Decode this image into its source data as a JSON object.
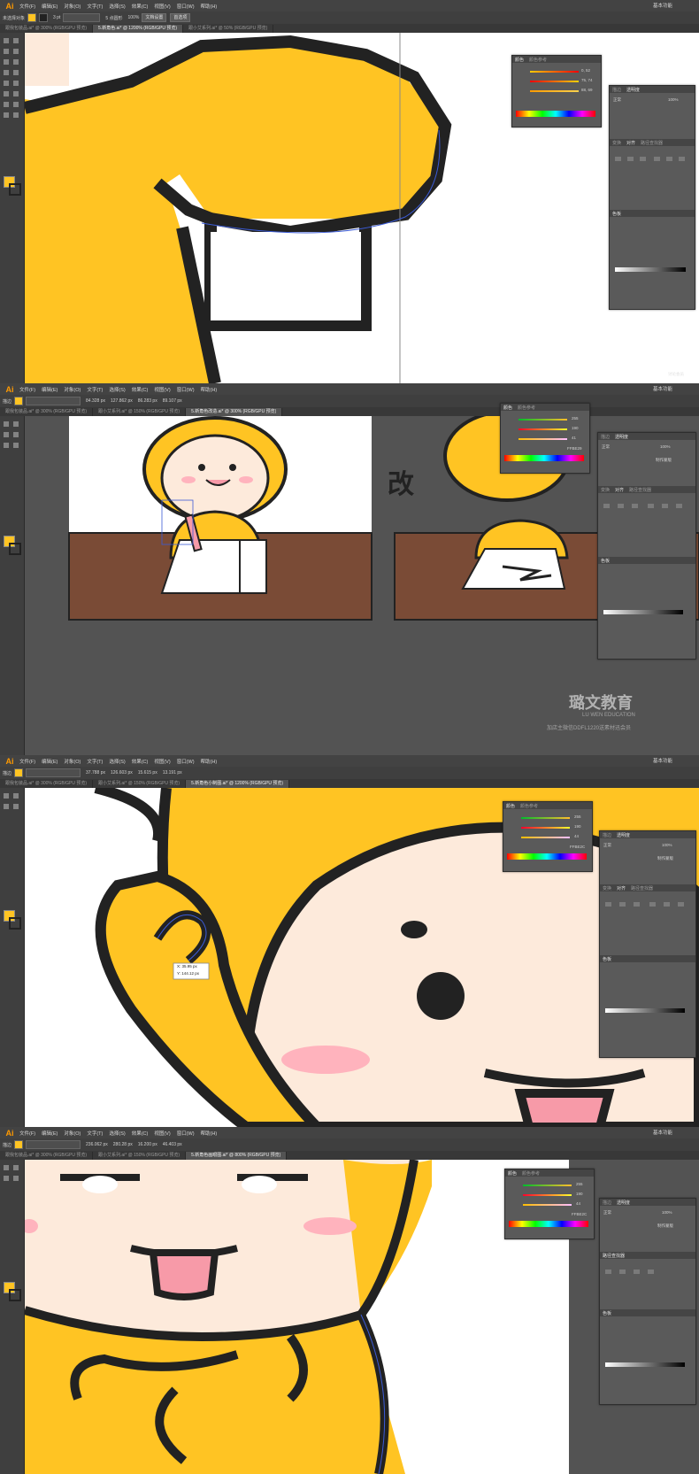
{
  "app": {
    "logo": "Ai",
    "workspace": "基本功能"
  },
  "menus": [
    "文件(F)",
    "编辑(E)",
    "对象(O)",
    "文字(T)",
    "选择(S)",
    "效果(C)",
    "视图(V)",
    "窗口(W)",
    "帮助(H)"
  ],
  "colors": {
    "yellow": "#ffc423",
    "outline": "#222222",
    "skin": "#fdeadb",
    "blush": "#ffb3bd",
    "tongue": "#f79aa8",
    "desk": "#7a4b36",
    "ui_dark": "#3f3f3f",
    "ui_panel": "#5a5a5a"
  },
  "shots": [
    {
      "control": {
        "label1": "未选择对象",
        "field1": "3 pt",
        "field2": "5 点圆形",
        "field3": "100%",
        "btn1": "文档设置",
        "btn2": "首选项"
      },
      "tabs": [
        "跟我包装品.ai* @ 300% (RGB/GPU 预览)",
        "5.新角色.ai* @ 1200% (RGB/GPU 预览)",
        "跟小艾系列.ai* @ 50% (RGB/GPU 预览)"
      ],
      "active_tab": 1,
      "panels": {
        "color": [
          "颜色",
          "颜色参考"
        ],
        "color_vals": [
          "0, 52",
          "75, 74",
          "88, 69"
        ],
        "transp": [
          "描边",
          "透明度"
        ],
        "transp_mode": "正常",
        "transp_opacity": "100%",
        "align": [
          "变换",
          "对齐",
          "路径查找器"
        ],
        "swatch": "色板"
      },
      "watermark": "讨论会员"
    },
    {
      "control": {
        "label1": "描边",
        "field1": "84.328 px",
        "field2": "127.862 px",
        "field3": "86.283 px",
        "field4": "89.107 px"
      },
      "tabs": [
        "跟我包装品.ai* @ 300% (RGB/GPU 预览)",
        "跟小艾系列.ai* @ 150% (RGB/GPU 预览)",
        "5.新角色改造.ai* @ 300% (RGB/GPU 预览)"
      ],
      "active_tab": 2,
      "panels": {
        "color": [
          "颜色",
          "颜色参考"
        ],
        "color_vals": [
          "255",
          "190",
          "41"
        ],
        "hex": "FFBE29",
        "transp": [
          "描边",
          "透明度"
        ],
        "transp_mode": "正常",
        "transp_opacity": "100%",
        "mask": "制作蒙版",
        "align": [
          "变换",
          "对齐",
          "路径查找器"
        ],
        "swatch": "色板"
      },
      "annotation": "改",
      "watermark": {
        "brand": "璐文教育",
        "en": "LU WEN EDUCATION",
        "sub": "加店主微信DDFL1220送素材迅会员"
      }
    },
    {
      "control": {
        "label1": "描边",
        "field1": "37.788 px",
        "field2": "126.603 px",
        "field3": "15.615 px",
        "field4": "13.191 px"
      },
      "tabs": [
        "跟我包装品.ai* @ 300% (RGB/GPU 预览)",
        "跟小艾系列.ai* @ 150% (RGB/GPU 预览)",
        "5.新角色小制图.ai* @ 1200% (RGB/GPU 预览)"
      ],
      "active_tab": 2,
      "panels": {
        "color": [
          "颜色",
          "颜色参考"
        ],
        "color_vals": [
          "255",
          "190",
          "44"
        ],
        "hex": "FFBE2C",
        "transp": [
          "描边",
          "透明度"
        ],
        "transp_mode": "正常",
        "transp_opacity": "100%",
        "mask": "制作蒙版",
        "align": [
          "变换",
          "对齐",
          "路径查找器"
        ],
        "swatch": "色板"
      },
      "tooltip": [
        "X: 35.95 px",
        "Y: 144.12 px"
      ]
    },
    {
      "control": {
        "label1": "描边",
        "field1": "236.062 px",
        "field2": "280.28 px",
        "field3": "16.200 px",
        "field4": "46.403 px"
      },
      "tabs": [
        "跟我包装品.ai* @ 300% (RGB/GPU 预览)",
        "跟小艾系列.ai* @ 150% (RGB/GPU 预览)",
        "5.新角色画眼图.ai* @ 800% (RGB/GPU 预览)"
      ],
      "active_tab": 2,
      "panels": {
        "color": [
          "颜色",
          "颜色参考"
        ],
        "color_vals": [
          "255",
          "190",
          "44"
        ],
        "hex": "FFBE2C",
        "transp": [
          "描边",
          "透明度"
        ],
        "transp_mode": "正常",
        "transp_opacity": "100%",
        "mask": "制作蒙版",
        "pathfinder": "路径查找器",
        "swatch": "色板"
      }
    }
  ]
}
